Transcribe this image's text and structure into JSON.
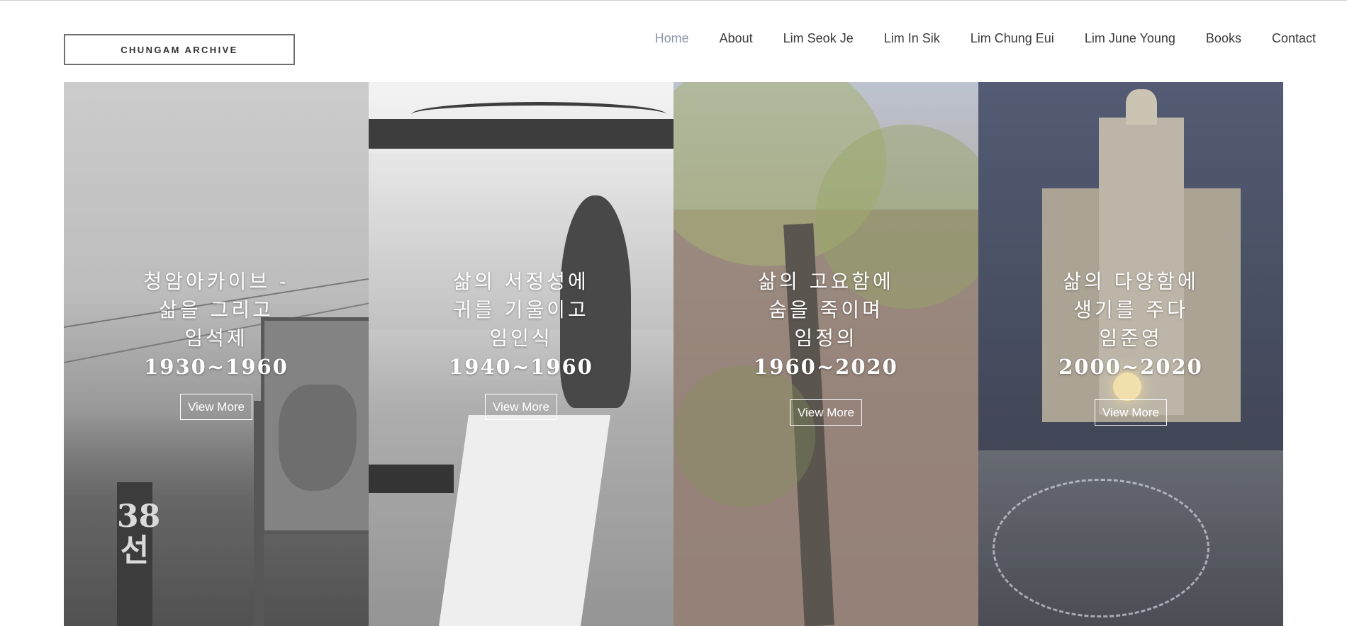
{
  "header": {
    "logo": "CHUNGAM ARCHIVE",
    "nav": [
      "Home",
      "About",
      "Lim Seok Je",
      "Lim In Sik",
      "Lim Chung Eui",
      "Lim June Young",
      "Books",
      "Contact"
    ],
    "active": "Home",
    "active_color": "#8c96aa"
  },
  "panels": [
    {
      "lines": [
        "청암아카이브 -",
        "삶을 그리고",
        "임석제"
      ],
      "years": "1930~1960",
      "button": "View More",
      "marker": "38선"
    },
    {
      "lines": [
        "삶의 서정성에",
        "귀를 기울이고",
        "임인식"
      ],
      "years": "1940~1960",
      "button": "View More"
    },
    {
      "lines": [
        "삶의 고요함에",
        "숨을 죽이며",
        "임정의"
      ],
      "years": "1960~2020",
      "button": "View More"
    },
    {
      "lines": [
        "삶의 다양함에",
        "생기를 주다",
        "임준영"
      ],
      "years": "2000~2020",
      "button": "View More"
    }
  ]
}
